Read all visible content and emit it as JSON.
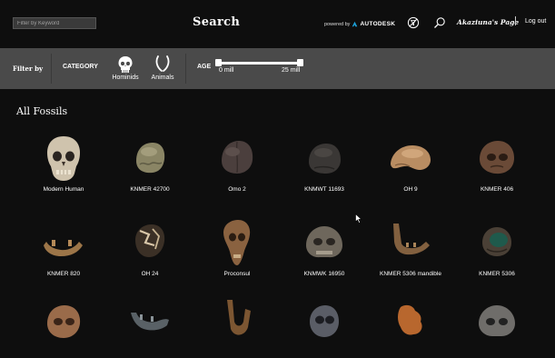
{
  "header": {
    "search_placeholder": "Filter by Keyword",
    "title": "Search",
    "powered_by": "powered by",
    "brand": "AUTODESK",
    "user_link": "Akaziuna's Page",
    "logout": "Log out",
    "icons": [
      "filter-off-icon",
      "search-icon"
    ]
  },
  "filters": {
    "label": "Filter by",
    "category_label": "CATEGORY",
    "categories": [
      {
        "label": "Hominids",
        "icon": "skull-icon"
      },
      {
        "label": "Animals",
        "icon": "horns-icon"
      }
    ],
    "age_label": "AGE",
    "age_min": "0 mill",
    "age_max": "25 mill"
  },
  "gallery": {
    "title": "All Fossils",
    "row1": [
      "Modern Human",
      "KNMER 42700",
      "Omo 2",
      "KNMWT 11693",
      "OH 9",
      "KNMER 406"
    ],
    "row2": [
      "KNMER 820",
      "OH 24",
      "Proconsul",
      "KNMWK 16950",
      "KNMER 5306 mandible",
      "KNMER 5306"
    ],
    "row3": [
      "",
      "",
      "",
      "",
      "",
      ""
    ]
  },
  "colors": {
    "background": "#0e0e0e",
    "filter_bar": "#4a4a4a",
    "text": "#ffffff",
    "input_bg": "#3a3a3a"
  }
}
